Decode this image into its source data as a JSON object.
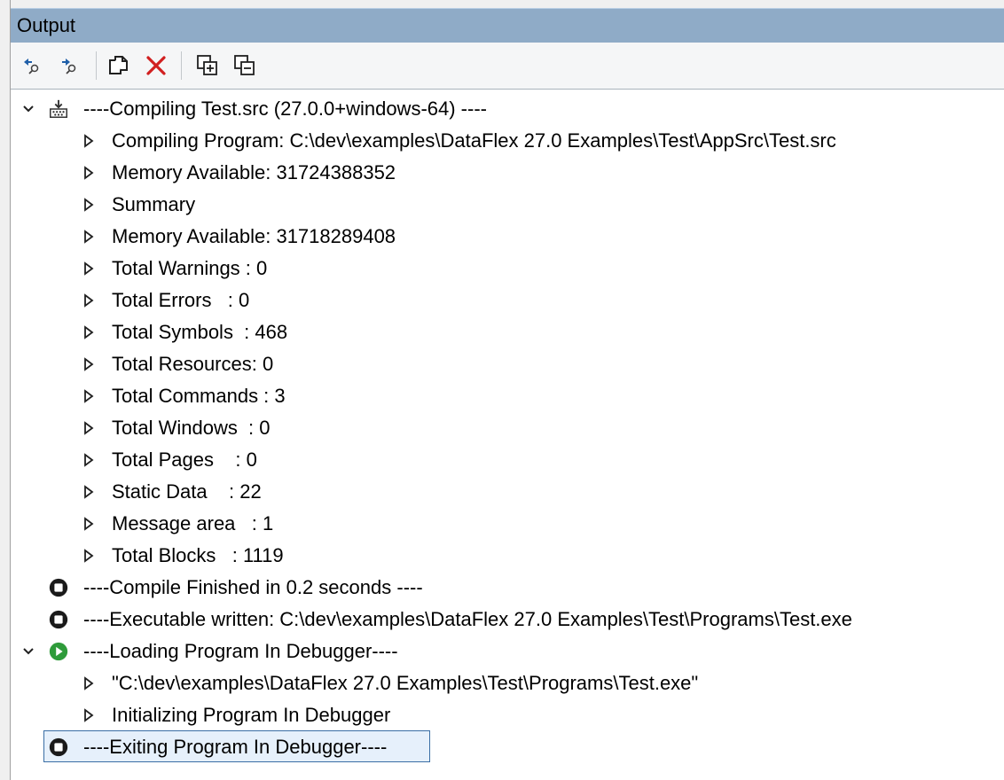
{
  "panel": {
    "title": "Output"
  },
  "toolbar": {
    "buttons": [
      {
        "name": "go-to-previous-message-icon"
      },
      {
        "name": "go-to-next-message-icon"
      },
      {
        "name": "copy-icon"
      },
      {
        "name": "clear-icon"
      },
      {
        "name": "expand-all-icon"
      },
      {
        "name": "collapse-all-icon"
      }
    ]
  },
  "tree": {
    "items": [
      {
        "text": "----Compiling Test.src (27.0.0+windows-64) ----",
        "expanded": true,
        "icon": "compile-icon"
      },
      {
        "text": "Compiling Program: C:\\dev\\examples\\DataFlex 27.0 Examples\\Test\\AppSrc\\Test.src"
      },
      {
        "text": "Memory Available: 31724388352"
      },
      {
        "text": "Summary"
      },
      {
        "text": "Memory Available: 31718289408"
      },
      {
        "text": "Total Warnings : 0"
      },
      {
        "text": "Total Errors   : 0"
      },
      {
        "text": "Total Symbols  : 468"
      },
      {
        "text": "Total Resources: 0"
      },
      {
        "text": "Total Commands : 3"
      },
      {
        "text": "Total Windows  : 0"
      },
      {
        "text": "Total Pages    : 0"
      },
      {
        "text": "Static Data    : 22"
      },
      {
        "text": "Message area   : 1"
      },
      {
        "text": "Total Blocks   : 1119"
      },
      {
        "text": "----Compile Finished in 0.2 seconds ----",
        "icon": "stop-icon"
      },
      {
        "text": "----Executable written: C:\\dev\\examples\\DataFlex 27.0 Examples\\Test\\Programs\\Test.exe",
        "icon": "stop-icon"
      },
      {
        "text": "----Loading Program In Debugger----",
        "expanded": true,
        "icon": "play-icon"
      },
      {
        "text": "\"C:\\dev\\examples\\DataFlex 27.0 Examples\\Test\\Programs\\Test.exe\""
      },
      {
        "text": "Initializing Program In Debugger"
      },
      {
        "text": "----Exiting Program In Debugger----",
        "icon": "stop-icon",
        "selected": true
      }
    ]
  },
  "colors": {
    "title_bar": "#8fabc7",
    "play_green": "#2e9b3a",
    "clear_red": "#d11f1f"
  }
}
